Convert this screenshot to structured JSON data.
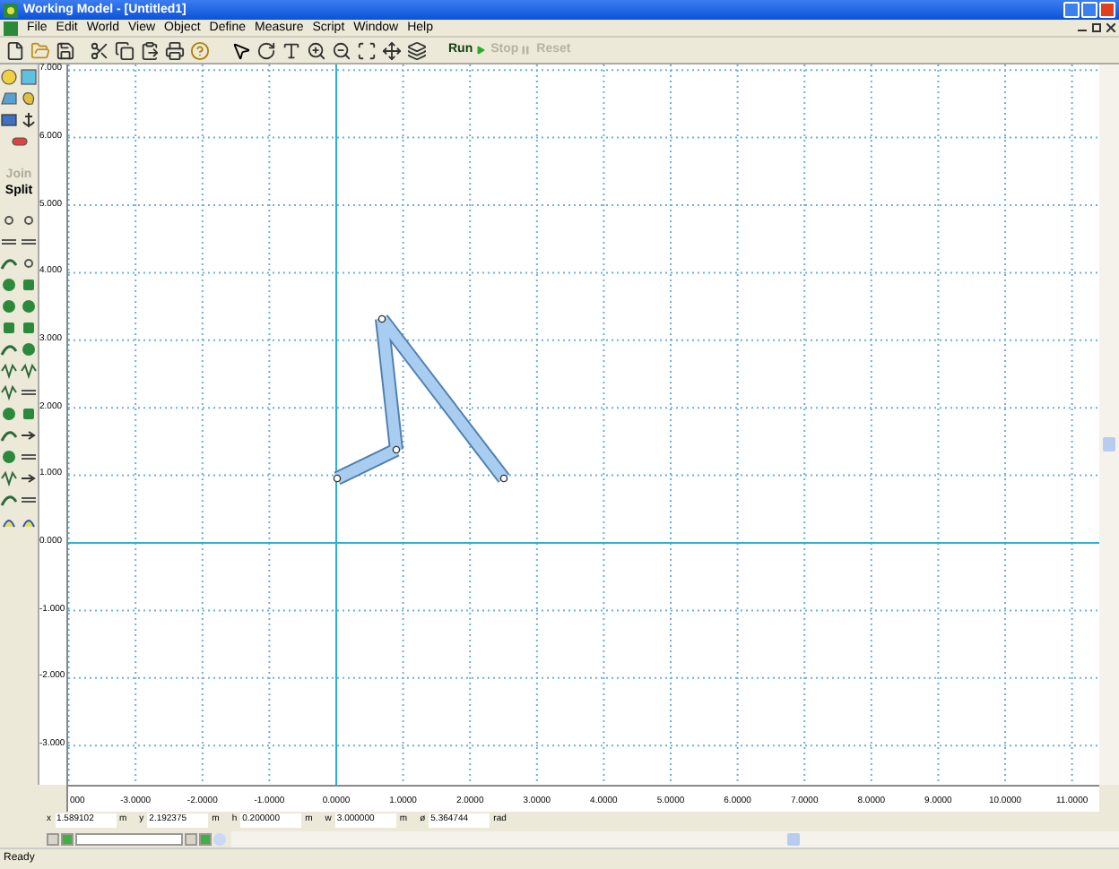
{
  "window": {
    "title": "Working Model - [Untitled1]"
  },
  "menu": [
    "File",
    "Edit",
    "World",
    "View",
    "Object",
    "Define",
    "Measure",
    "Script",
    "Window",
    "Help"
  ],
  "run_controls": [
    {
      "label": "Run",
      "disabled": false
    },
    {
      "label": "Stop",
      "disabled": true
    },
    {
      "label": "Reset",
      "disabled": true
    }
  ],
  "toolbox_buttons": [
    {
      "label": "Join",
      "disabled": true
    },
    {
      "label": "Split",
      "disabled": false
    }
  ],
  "y_ruler": [
    "7.000",
    "6.000",
    "5.000",
    "4.000",
    "3.000",
    "2.000",
    "1.000",
    "0.000",
    "-1.000",
    "-2.000",
    "-3.000"
  ],
  "x_ruler": [
    "000",
    "-3.0000",
    "-2.0000",
    "-1.0000",
    "0.0000",
    "1.0000",
    "2.0000",
    "3.0000",
    "4.0000",
    "5.0000",
    "6.0000",
    "7.0000",
    "8.0000",
    "9.0000",
    "10.0000",
    "11.0000"
  ],
  "coordinates": [
    {
      "label": "x",
      "value": "1.589102",
      "unit": "m"
    },
    {
      "label": "y",
      "value": "2.192375",
      "unit": "m"
    },
    {
      "label": "h",
      "value": "0.200000",
      "unit": "m"
    },
    {
      "label": "w",
      "value": "3.000000",
      "unit": "m"
    },
    {
      "label": "ø",
      "value": "5.364744",
      "unit": "rad"
    }
  ],
  "status_bar": "Ready"
}
